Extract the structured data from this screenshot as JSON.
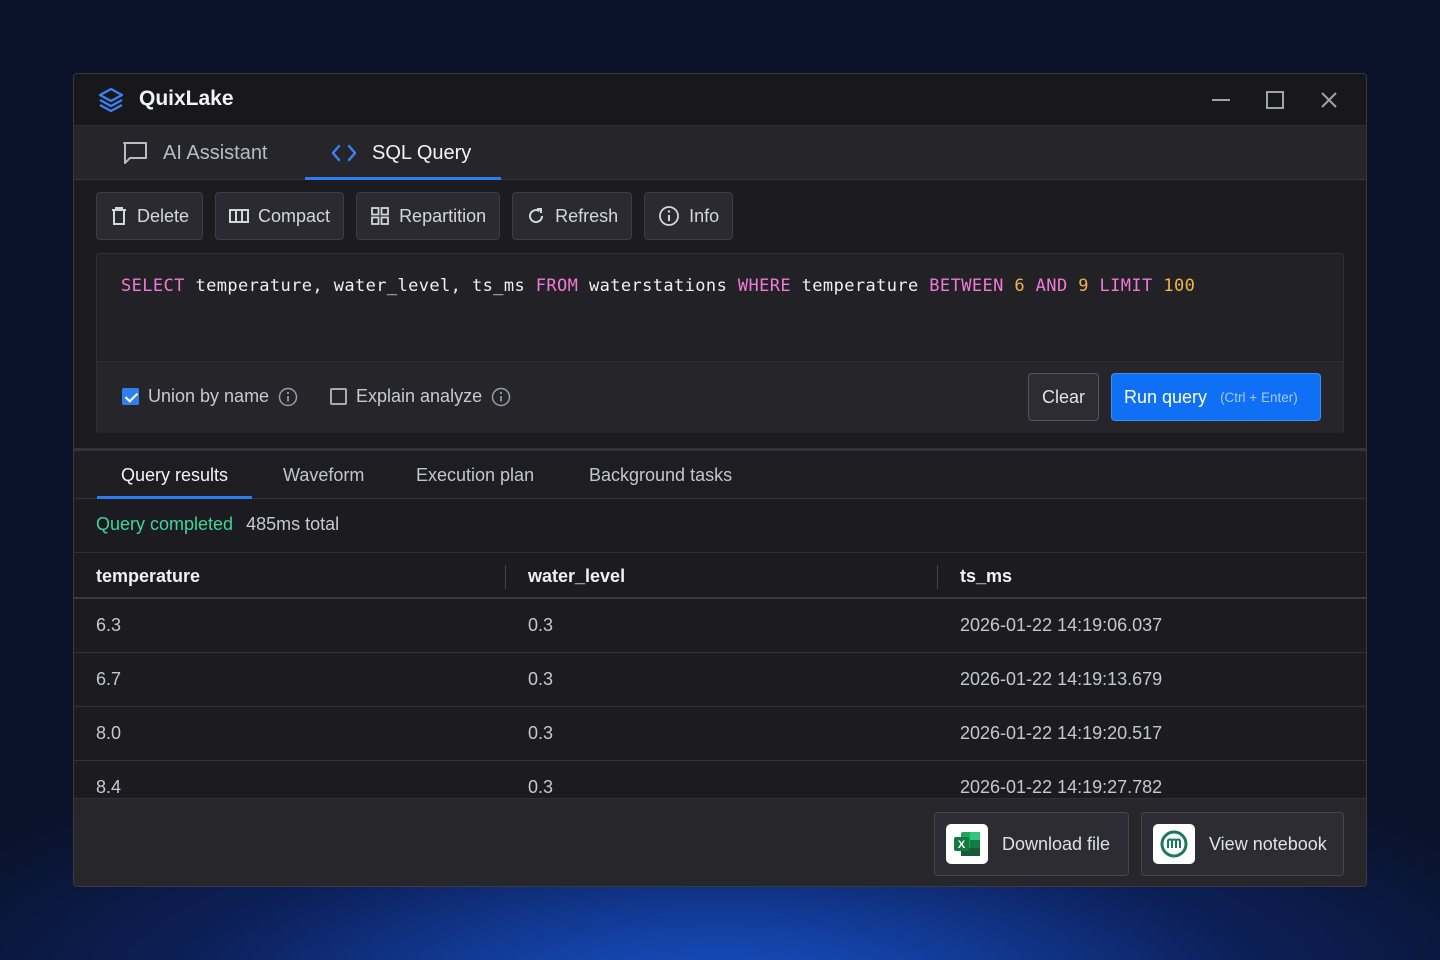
{
  "app": {
    "title": "QuixLake"
  },
  "window_controls": [
    "minimize-icon",
    "maximize-icon",
    "close-icon"
  ],
  "main_tabs": [
    {
      "label": "AI Assistant",
      "icon": "chat-icon",
      "active": false
    },
    {
      "label": "SQL Query",
      "icon": "code-icon",
      "active": true
    }
  ],
  "toolbar": {
    "delete": "Delete",
    "compact": "Compact",
    "repartition": "Repartition",
    "refresh": "Refresh",
    "info": "Info"
  },
  "editor": {
    "tokens": [
      {
        "t": "SELECT",
        "k": "kw"
      },
      {
        "t": " temperature, water_level, ts_ms ",
        "k": "id"
      },
      {
        "t": "FROM",
        "k": "kw"
      },
      {
        "t": " waterstations ",
        "k": "id"
      },
      {
        "t": "WHERE",
        "k": "kw"
      },
      {
        "t": " temperature ",
        "k": "id"
      },
      {
        "t": "BETWEEN",
        "k": "kw"
      },
      {
        "t": " ",
        "k": "id"
      },
      {
        "t": "6",
        "k": "num"
      },
      {
        "t": " ",
        "k": "id"
      },
      {
        "t": "AND",
        "k": "kw"
      },
      {
        "t": " ",
        "k": "id"
      },
      {
        "t": "9",
        "k": "num"
      },
      {
        "t": " ",
        "k": "id"
      },
      {
        "t": "LIMIT",
        "k": "kw"
      },
      {
        "t": " ",
        "k": "id"
      },
      {
        "t": "100",
        "k": "num"
      }
    ],
    "options": {
      "union_by_name": {
        "label": "Union by name",
        "checked": true
      },
      "explain_analyze": {
        "label": "Explain analyze",
        "checked": false
      }
    },
    "clear_label": "Clear",
    "run_label": "Run query",
    "run_hint": "(Ctrl + Enter)"
  },
  "results_tabs": [
    "Query results",
    "Waveform",
    "Execution plan",
    "Background tasks"
  ],
  "status": {
    "state": "Query completed",
    "time": "485ms total"
  },
  "table": {
    "columns": [
      "temperature",
      "water_level",
      "ts_ms"
    ],
    "rows": [
      [
        "6.3",
        "0.3",
        "2026-01-22 14:19:06.037"
      ],
      [
        "6.7",
        "0.3",
        "2026-01-22 14:19:13.679"
      ],
      [
        "8.0",
        "0.3",
        "2026-01-22 14:19:20.517"
      ],
      [
        "8.4",
        "0.3",
        "2026-01-22 14:19:27.782"
      ]
    ]
  },
  "footer": {
    "download_label": "Download file",
    "notebook_label": "View notebook"
  },
  "colors": {
    "accent": "#2c7cf0",
    "run_button": "#0f6ff5",
    "success": "#3fd49b",
    "keyword": "#f07ad8",
    "number": "#f0b54a"
  }
}
